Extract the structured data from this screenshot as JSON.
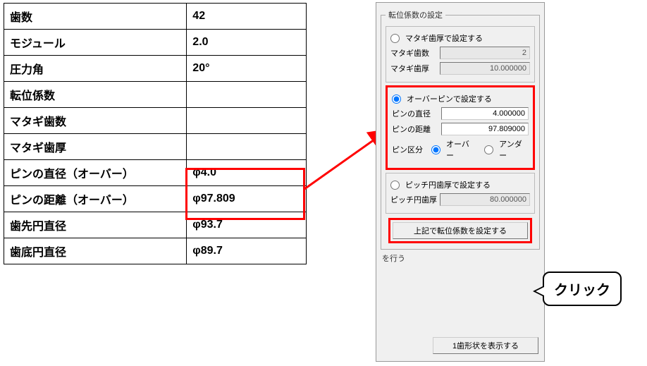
{
  "table": {
    "rows": [
      {
        "label": "歯数",
        "value": "42"
      },
      {
        "label": "モジュール",
        "value": "2.0"
      },
      {
        "label": "圧力角",
        "value": "20°"
      },
      {
        "label": "転位係数",
        "value": ""
      },
      {
        "label": "マタギ歯数",
        "value": ""
      },
      {
        "label": "マタギ歯厚",
        "value": ""
      },
      {
        "label": "ピンの直径（オーバー）",
        "value": "φ4.0"
      },
      {
        "label": "ピンの距離（オーバー）",
        "value": "φ97.809"
      },
      {
        "label": "歯先円直径",
        "value": "φ93.7"
      },
      {
        "label": "歯底円直径",
        "value": "φ89.7"
      }
    ]
  },
  "panel": {
    "group_legend": "転位係数の設定",
    "matagi": {
      "radio_label": "マタギ歯厚で設定する",
      "teeth_label": "マタギ歯数",
      "teeth_value": "2",
      "thick_label": "マタギ歯厚",
      "thick_value": "10.000000"
    },
    "overpin": {
      "radio_label": "オーバーピンで設定する",
      "dia_label": "ピンの直径",
      "dia_value": "4.000000",
      "dist_label": "ピンの距離",
      "dist_value": "97.809000",
      "class_label": "ピン区分",
      "over_label": "オーバー",
      "under_label": "アンダー"
    },
    "pitch": {
      "radio_label": "ピッチ円歯厚で設定する",
      "thick_label": "ピッチ円歯厚",
      "thick_value": "80.000000"
    },
    "set_button": "上記で転位係数を設定する",
    "truncated": "を行う",
    "show_button": "1歯形状を表示する"
  },
  "callout": "クリック"
}
